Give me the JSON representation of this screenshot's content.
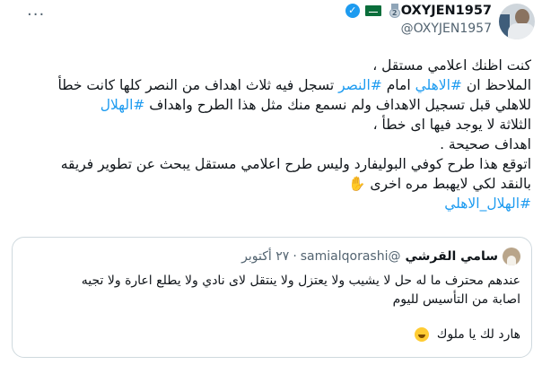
{
  "tweet": {
    "more_label": "···",
    "author_name": "OXYJEN1957",
    "medal_digit": "2",
    "handle": "@OXYJEN1957",
    "lines": [
      [
        {
          "t": "كنت اظنك اعلامي مستقل ،",
          "tag": false
        }
      ],
      [
        {
          "t": "الملاحظ ان ",
          "tag": false
        },
        {
          "t": "#الاهلي",
          "tag": true
        },
        {
          "t": " امام ",
          "tag": false
        },
        {
          "t": "#النصر",
          "tag": true
        },
        {
          "t": " تسجل فيه ثلاث اهداف من النصر كلها كانت خطأ",
          "tag": false
        }
      ],
      [
        {
          "t": "للاهلي قبل تسجيل الاهداف ولم نسمع منك مثل هذا الطرح واهداف ",
          "tag": false
        },
        {
          "t": "#الهلال",
          "tag": true
        }
      ],
      [
        {
          "t": "الثلاثة لا يوجد فيها اى خطأ ،",
          "tag": false
        }
      ],
      [
        {
          "t": "اهداف صحيحة .",
          "tag": false
        }
      ],
      [
        {
          "t": "اتوقع هذا طرح كوفي البوليفارد وليس طرح اعلامي مستقل يبحث عن تطوير فريقه",
          "tag": false
        }
      ],
      [
        {
          "t": "بالنقد لكي لايهبط مره اخرى ",
          "tag": false
        },
        {
          "t": "✋",
          "tag": false,
          "emoji": true
        }
      ],
      [
        {
          "t": "#الهلال_الاهلي",
          "tag": true
        }
      ]
    ]
  },
  "quote": {
    "name": "سامي القرشي",
    "handle": "@samialqorashi",
    "dot": "·",
    "date": "٢٧ أكتوبر",
    "lines": [
      "عندهم محترف ما له حل لا يشيب ولا يعتزل ولا ينتقل لاى نادي ولا يطلع اعارة ولا تجيه",
      "اصابة من التأسيس لليوم"
    ],
    "last_line": "هارد لك يا ملوك"
  }
}
